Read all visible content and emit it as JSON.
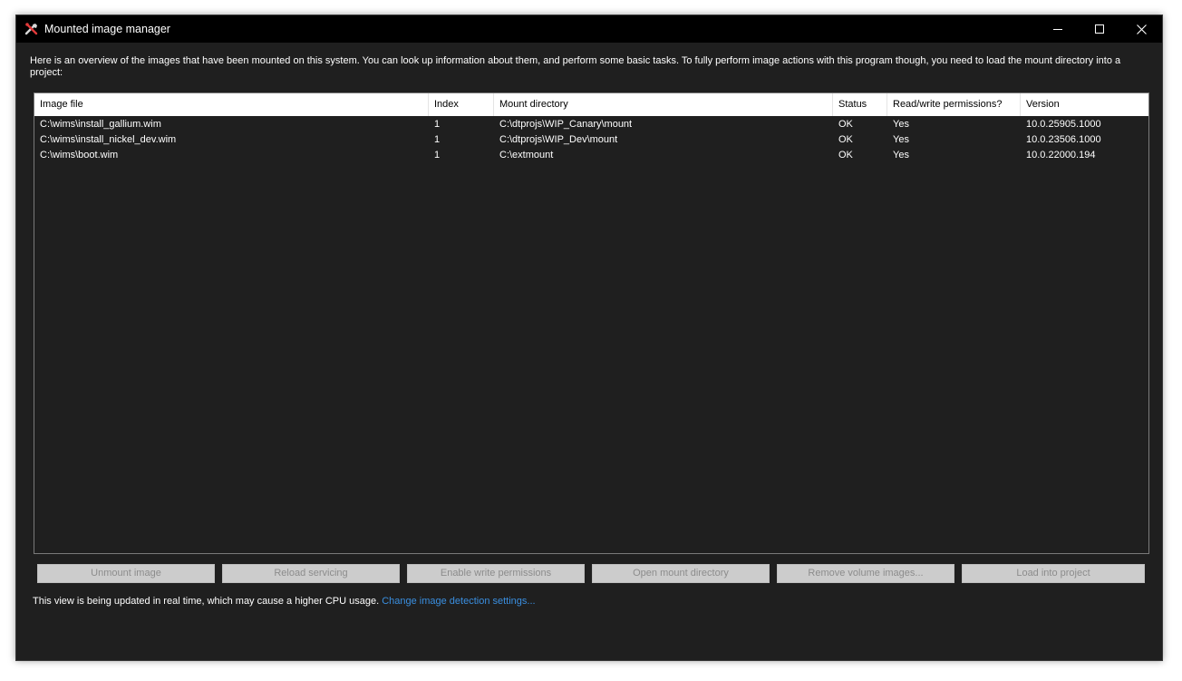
{
  "window": {
    "title": "Mounted image manager"
  },
  "intro_text": "Here is an overview of the images that have been mounted on this system. You can look up information about them, and perform some basic tasks. To fully perform image actions with this program though, you need to load the mount directory into a project:",
  "table": {
    "columns": [
      "Image file",
      "Index",
      "Mount directory",
      "Status",
      "Read/write permissions?",
      "Version"
    ],
    "rows": [
      [
        "C:\\wims\\install_gallium.wim",
        "1",
        "C:\\dtprojs\\WIP_Canary\\mount",
        "OK",
        "Yes",
        "10.0.25905.1000"
      ],
      [
        "C:\\wims\\install_nickel_dev.wim",
        "1",
        "C:\\dtprojs\\WIP_Dev\\mount",
        "OK",
        "Yes",
        "10.0.23506.1000"
      ],
      [
        "C:\\wims\\boot.wim",
        "1",
        "C:\\extmount",
        "OK",
        "Yes",
        "10.0.22000.194"
      ]
    ]
  },
  "buttons": {
    "unmount": "Unmount image",
    "reload": "Reload servicing",
    "enable_write": "Enable write permissions",
    "open_dir": "Open mount directory",
    "remove_volume": "Remove volume images...",
    "load_project": "Load into project"
  },
  "footer": {
    "text": "This view is being updated in real time, which may cause a higher CPU usage.",
    "link": "Change image detection settings..."
  },
  "colors": {
    "background": "#1f1f1f",
    "titlebar": "#000000",
    "link": "#3a8fe0",
    "button_disabled": "#cccccc"
  },
  "icons": {
    "app": "tools-icon",
    "minimize": "minimize-icon",
    "maximize": "maximize-icon",
    "close": "close-icon"
  }
}
